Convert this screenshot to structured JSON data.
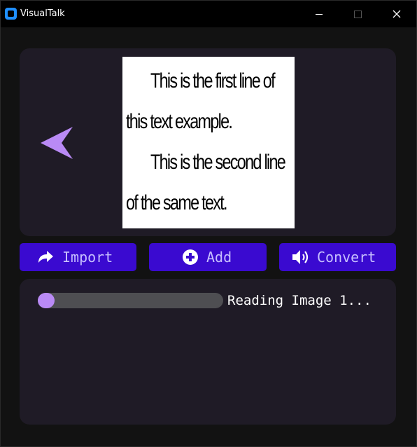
{
  "window": {
    "title": "VisualTalk",
    "controls": [
      "minimize",
      "maximize",
      "close"
    ]
  },
  "image_panel": {
    "nav_icon": "back-arrow-icon",
    "text_lines": [
      "This is the first line of",
      "this text example.",
      "This is the second line",
      "of the same text."
    ]
  },
  "buttons": {
    "import": {
      "label": "Import",
      "icon": "share-arrow-icon"
    },
    "add": {
      "label": "Add",
      "icon": "plus-circle-icon"
    },
    "convert": {
      "label": "Convert",
      "icon": "speaker-icon"
    }
  },
  "progress": {
    "status_text": "Reading Image 1...",
    "value": 0
  },
  "colors": {
    "accent_button": "#3a0ad0",
    "accent_purple": "#b98af5",
    "panel_bg": "#1f1b26",
    "window_bg": "#121212"
  }
}
